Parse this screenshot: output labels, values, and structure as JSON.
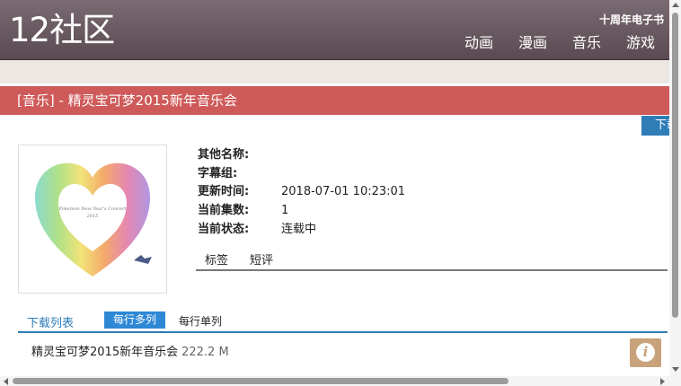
{
  "header": {
    "logo": "12社区",
    "ebook_link": "十周年电子书",
    "nav": [
      "动画",
      "漫画",
      "音乐",
      "游戏"
    ]
  },
  "title_bar": {
    "title": "[音乐] - 精灵宝可梦2015新年音乐会"
  },
  "download_button": "下载",
  "cover": {
    "icon": "heart-artwork-image",
    "caption_lines": [
      "Pokémon New Year's Concert",
      "2015"
    ]
  },
  "info": {
    "rows": [
      {
        "label": "其他名称:",
        "value": ""
      },
      {
        "label": "字幕组:",
        "value": ""
      },
      {
        "label": "更新时间:",
        "value": "2018-07-01 10:23:01"
      },
      {
        "label": "当前集数:",
        "value": "1"
      },
      {
        "label": "当前状态:",
        "value": "连载中"
      }
    ]
  },
  "tabs": [
    "标签",
    "短评"
  ],
  "download_list": {
    "label": "下载列表",
    "view_multi": "每行多列",
    "view_single": "每行单列",
    "items": [
      {
        "name": "精灵宝可梦2015新年音乐会",
        "size": "222.2 M"
      }
    ]
  },
  "info_button": {
    "icon": "info-icon",
    "glyph": "i"
  },
  "colors": {
    "header": "#6b5b63",
    "title_bar": "#cf5a5a",
    "accent": "#2e7db7",
    "info_button": "#c8a27a"
  }
}
